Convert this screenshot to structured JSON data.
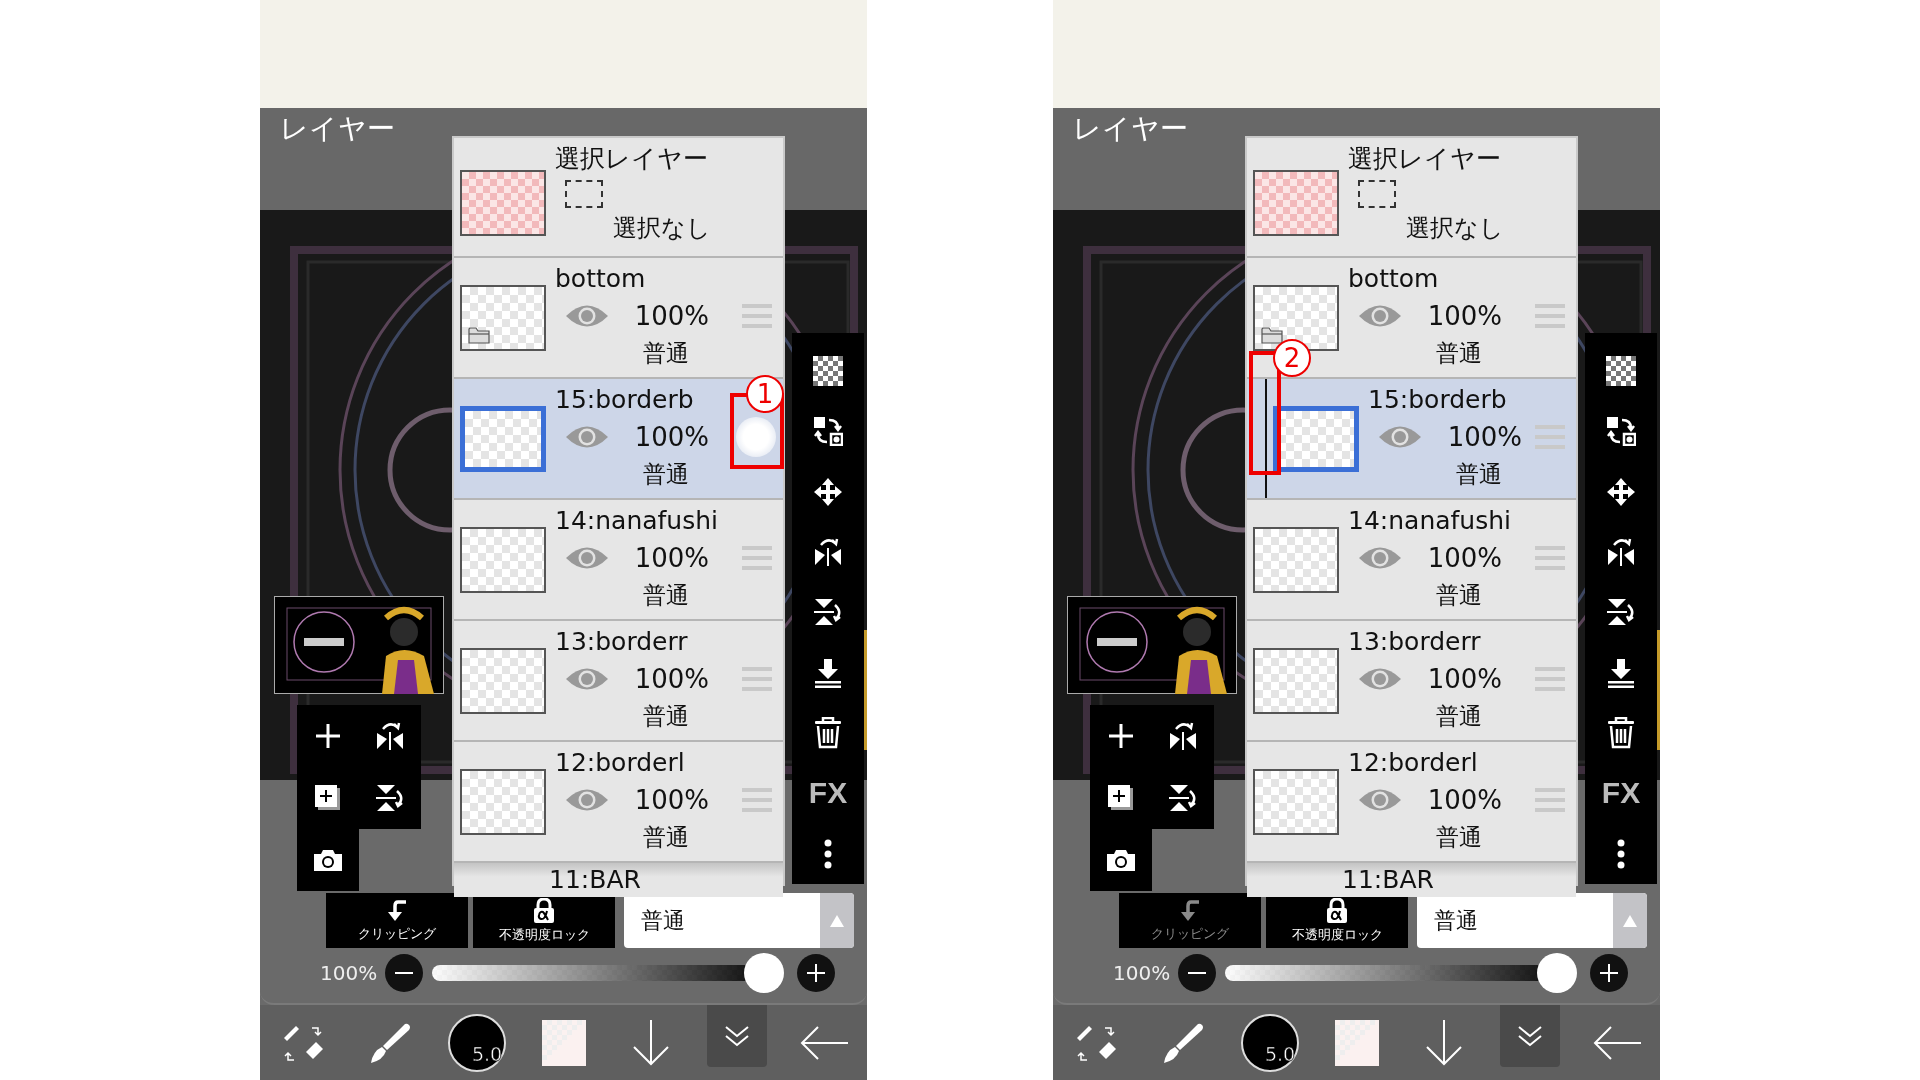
{
  "screens": [
    {
      "header": "レイヤー",
      "selection_layer": {
        "title": "選択レイヤー",
        "status": "選択なし"
      },
      "layers": [
        {
          "name": "bottom",
          "kind": "folder",
          "visible": true,
          "opacity": "100%",
          "blend": "普通",
          "selected": false,
          "clipped": false,
          "dragging": false
        },
        {
          "name": "15:borderb",
          "kind": "layer",
          "visible": true,
          "opacity": "100%",
          "blend": "普通",
          "selected": true,
          "clipped": false,
          "dragging": true,
          "callout": {
            "kind": "handle",
            "number": "1"
          }
        },
        {
          "name": "14:nanafushi",
          "kind": "layer",
          "visible": true,
          "opacity": "100%",
          "blend": "普通",
          "selected": false,
          "clipped": false,
          "dragging": false
        },
        {
          "name": "13:borderr",
          "kind": "layer",
          "visible": true,
          "opacity": "100%",
          "blend": "普通",
          "selected": false,
          "clipped": false,
          "dragging": false
        },
        {
          "name": "12:borderl",
          "kind": "layer",
          "visible": true,
          "opacity": "100%",
          "blend": "普通",
          "selected": false,
          "clipped": false,
          "dragging": false
        },
        {
          "name": "11:BAR",
          "kind": "partial"
        }
      ],
      "fx_label": "FX",
      "clipping": {
        "label": "クリッピング",
        "disabled": false
      },
      "alpha_lock": {
        "label": "不透明度ロック"
      },
      "blend_mode": "普通",
      "opacity": {
        "reading": "100%",
        "level": 1
      },
      "brush_size": "5.0"
    },
    {
      "header": "レイヤー",
      "selection_layer": {
        "title": "選択レイヤー",
        "status": "選択なし"
      },
      "layers": [
        {
          "name": "bottom",
          "kind": "folder",
          "visible": true,
          "opacity": "100%",
          "blend": "普通",
          "selected": false,
          "clipped": false,
          "dragging": false
        },
        {
          "name": "15:borderb",
          "kind": "layer",
          "visible": true,
          "opacity": "100%",
          "blend": "普通",
          "selected": true,
          "clipped": true,
          "dragging": false,
          "callout": {
            "kind": "clip",
            "number": "2"
          }
        },
        {
          "name": "14:nanafushi",
          "kind": "layer",
          "visible": true,
          "opacity": "100%",
          "blend": "普通",
          "selected": false,
          "clipped": false,
          "dragging": false
        },
        {
          "name": "13:borderr",
          "kind": "layer",
          "visible": true,
          "opacity": "100%",
          "blend": "普通",
          "selected": false,
          "clipped": false,
          "dragging": false
        },
        {
          "name": "12:borderl",
          "kind": "layer",
          "visible": true,
          "opacity": "100%",
          "blend": "普通",
          "selected": false,
          "clipped": false,
          "dragging": false
        },
        {
          "name": "11:BAR",
          "kind": "partial"
        }
      ],
      "fx_label": "FX",
      "clipping": {
        "label": "クリッピング",
        "disabled": true
      },
      "alpha_lock": {
        "label": "不透明度ロック"
      },
      "blend_mode": "普通",
      "opacity": {
        "reading": "100%",
        "level": 1
      },
      "brush_size": "5.0"
    }
  ]
}
